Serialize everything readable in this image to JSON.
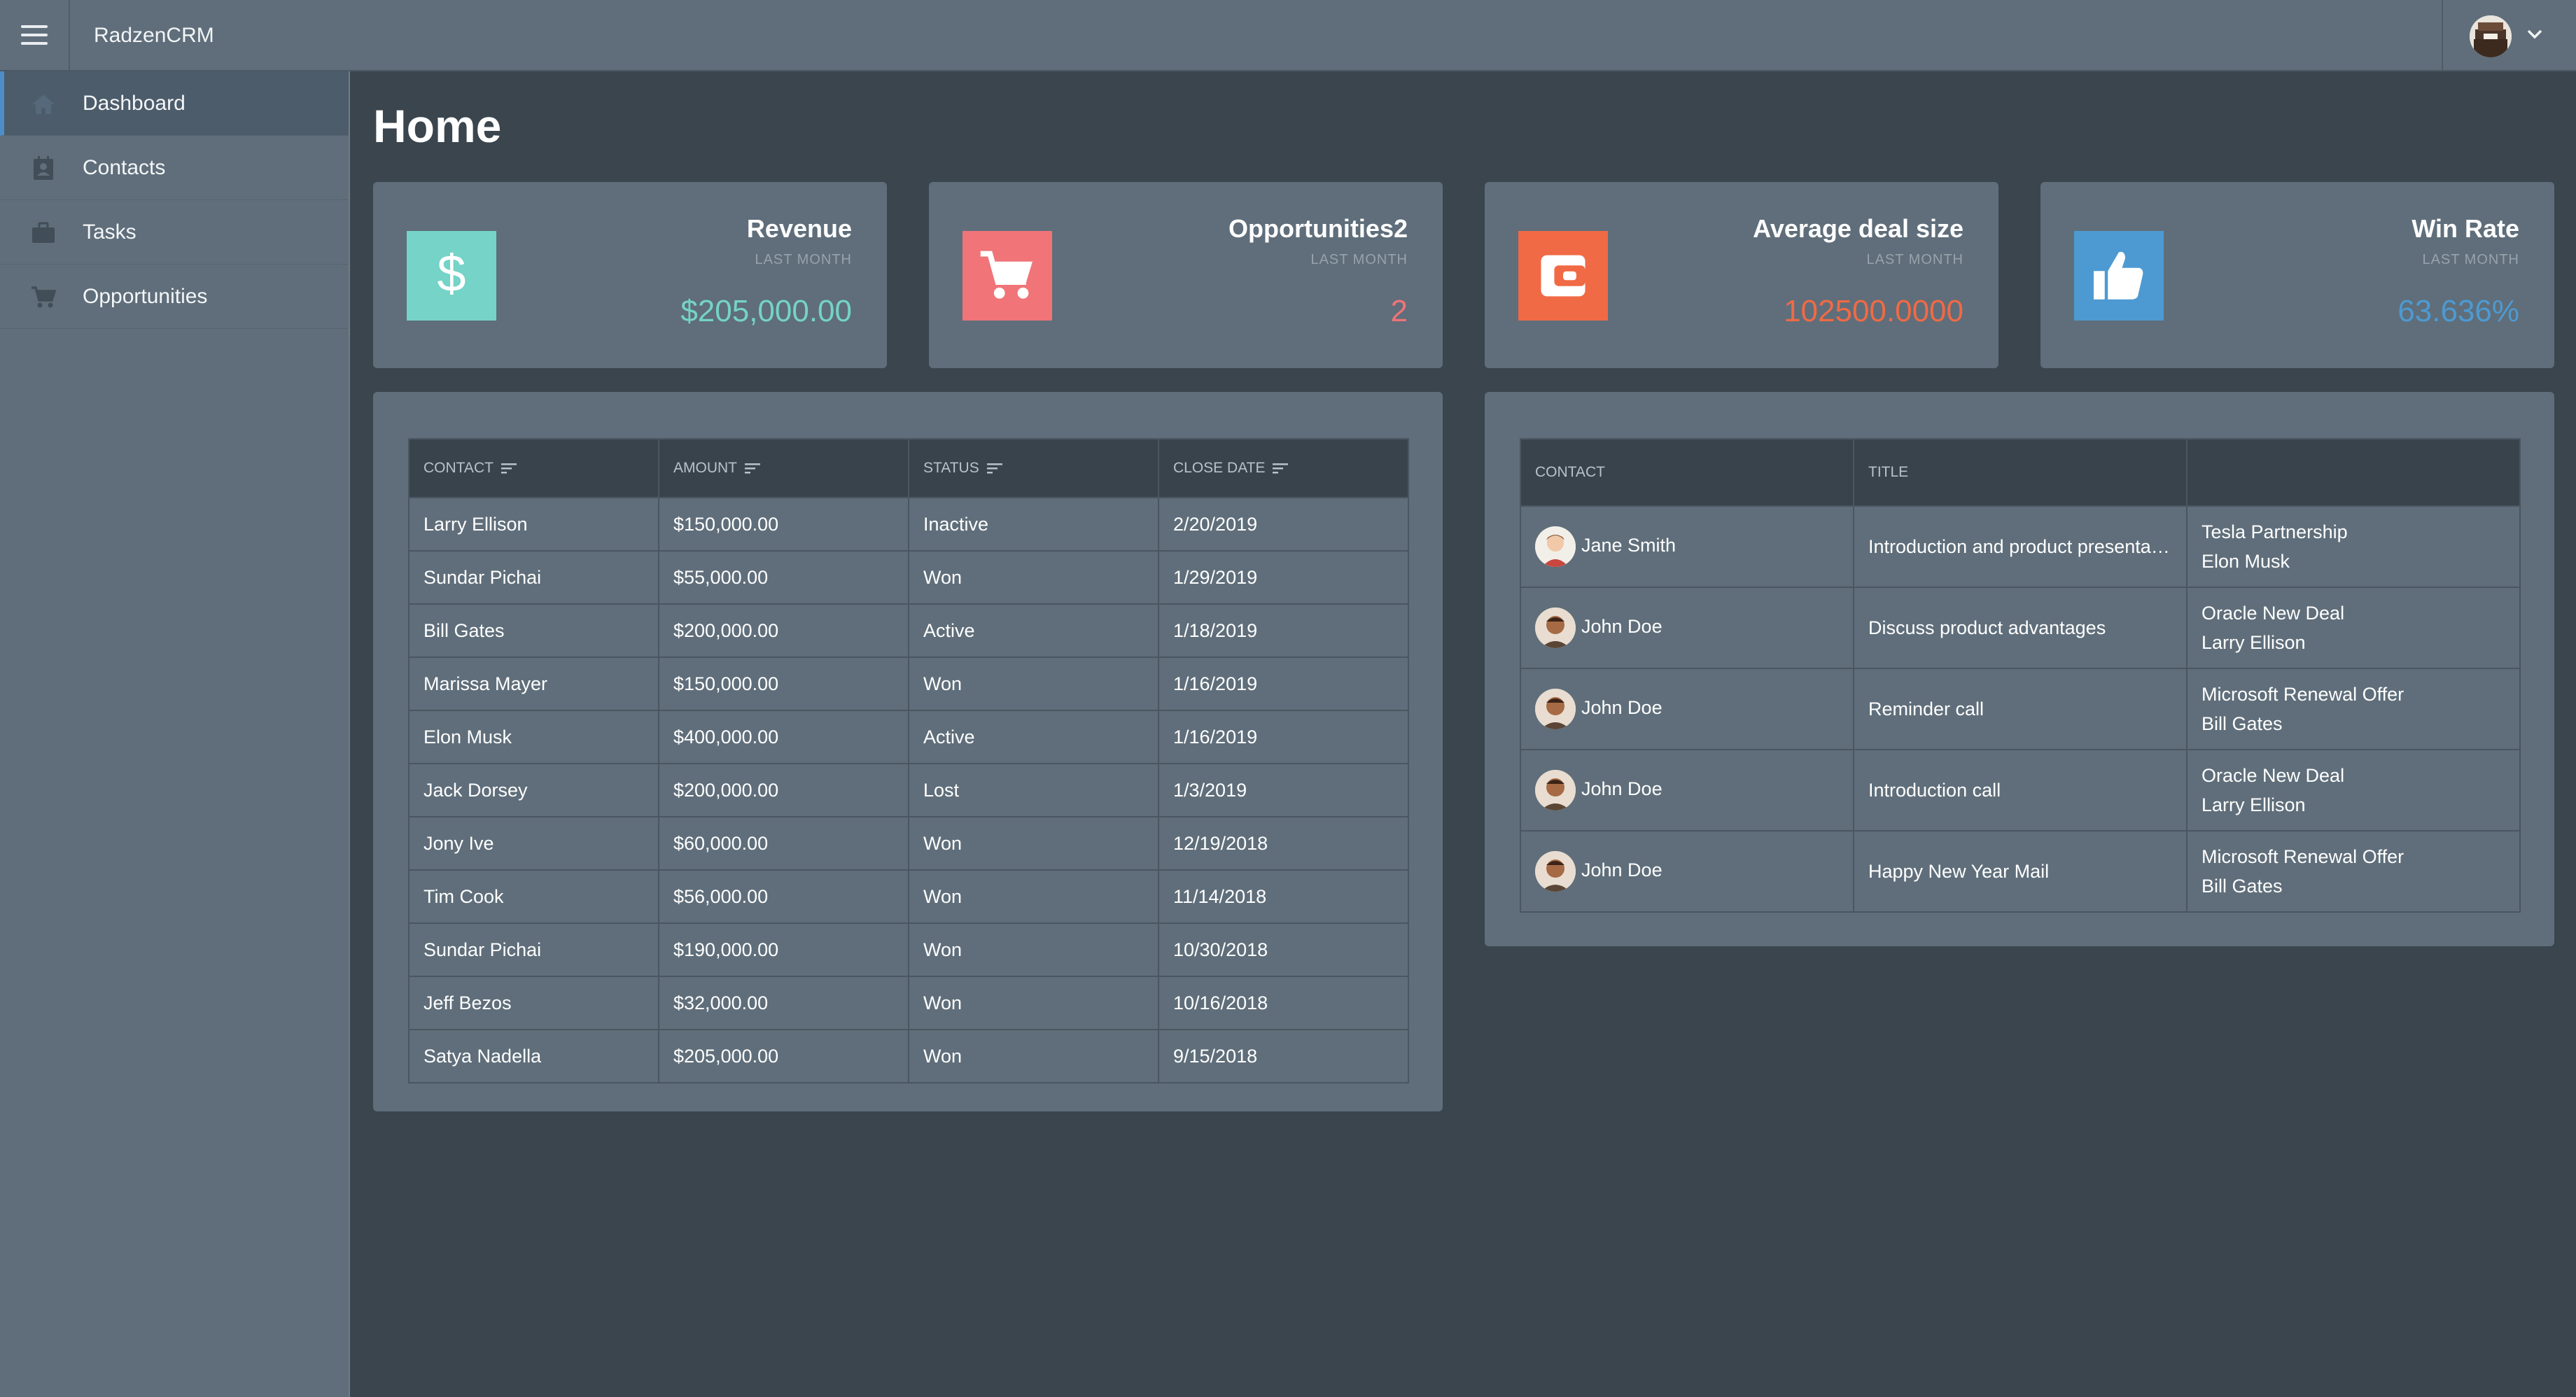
{
  "app": {
    "title": "RadzenCRM"
  },
  "sidebar": {
    "items": [
      {
        "label": "Dashboard",
        "icon": "home-icon",
        "active": true
      },
      {
        "label": "Contacts",
        "icon": "contacts-icon",
        "active": false
      },
      {
        "label": "Tasks",
        "icon": "briefcase-icon",
        "active": false
      },
      {
        "label": "Opportunities",
        "icon": "cart-icon",
        "active": false
      }
    ]
  },
  "page": {
    "title": "Home"
  },
  "cards": [
    {
      "title": "Revenue",
      "subtitle": "LAST MONTH",
      "value": "$205,000.00",
      "icon": "dollar-icon",
      "color": "#75d3c7"
    },
    {
      "title": "Opportunities2",
      "subtitle": "LAST MONTH",
      "value": "2",
      "icon": "cart-icon",
      "color": "#f07478"
    },
    {
      "title": "Average deal size",
      "subtitle": "LAST MONTH",
      "value": "102500.0000",
      "icon": "wallet-icon",
      "color": "#f06a45"
    },
    {
      "title": "Win Rate",
      "subtitle": "LAST MONTH",
      "value": "63.636%",
      "icon": "thumbs-up-icon",
      "color": "#4d9ad2"
    }
  ],
  "opportunities_grid": {
    "columns": [
      "CONTACT",
      "AMOUNT",
      "STATUS",
      "CLOSE DATE"
    ],
    "rows": [
      [
        "Larry Ellison",
        "$150,000.00",
        "Inactive",
        "2/20/2019"
      ],
      [
        "Sundar Pichai",
        "$55,000.00",
        "Won",
        "1/29/2019"
      ],
      [
        "Bill Gates",
        "$200,000.00",
        "Active",
        "1/18/2019"
      ],
      [
        "Marissa Mayer",
        "$150,000.00",
        "Won",
        "1/16/2019"
      ],
      [
        "Elon Musk",
        "$400,000.00",
        "Active",
        "1/16/2019"
      ],
      [
        "Jack Dorsey",
        "$200,000.00",
        "Lost",
        "1/3/2019"
      ],
      [
        "Jony Ive",
        "$60,000.00",
        "Won",
        "12/19/2018"
      ],
      [
        "Tim Cook",
        "$56,000.00",
        "Won",
        "11/14/2018"
      ],
      [
        "Sundar Pichai",
        "$190,000.00",
        "Won",
        "10/30/2018"
      ],
      [
        "Jeff Bezos",
        "$32,000.00",
        "Won",
        "10/16/2018"
      ],
      [
        "Satya Nadella",
        "$205,000.00",
        "Won",
        "9/15/2018"
      ]
    ]
  },
  "tasks_grid": {
    "columns": [
      "CONTACT",
      "TITLE",
      ""
    ],
    "rows": [
      {
        "contact": "Jane Smith",
        "title": "Introduction and product presenta…",
        "opportunity": "Tesla Partnership",
        "person": "Elon Musk"
      },
      {
        "contact": "John Doe",
        "title": "Discuss product advantages",
        "opportunity": "Oracle New Deal",
        "person": "Larry Ellison"
      },
      {
        "contact": "John Doe",
        "title": "Reminder call",
        "opportunity": "Microsoft Renewal Offer",
        "person": "Bill Gates"
      },
      {
        "contact": "John Doe",
        "title": "Introduction call",
        "opportunity": "Oracle New Deal",
        "person": "Larry Ellison"
      },
      {
        "contact": "John Doe",
        "title": "Happy New Year Mail",
        "opportunity": "Microsoft Renewal Offer",
        "person": "Bill Gates"
      }
    ]
  }
}
